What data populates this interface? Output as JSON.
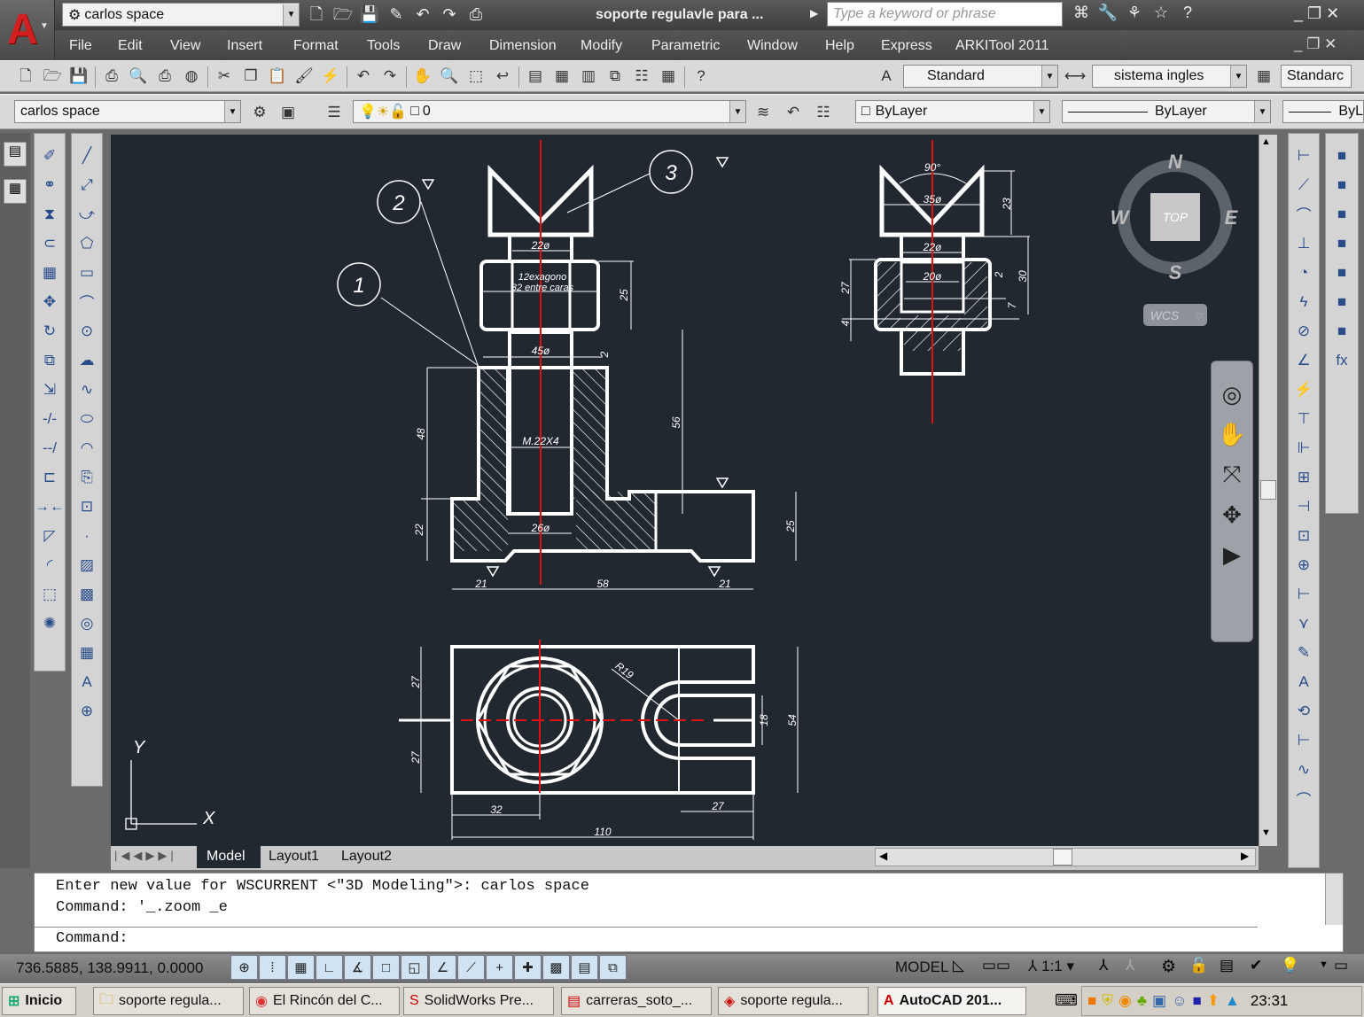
{
  "app": {
    "logo_letter": "A",
    "document_title": "soporte regulavle para ...",
    "search_placeholder": "Type a keyword or phrase",
    "workspace": "carlos space"
  },
  "menu": [
    "File",
    "Edit",
    "View",
    "Insert",
    "Format",
    "Tools",
    "Draw",
    "Dimension",
    "Modify",
    "Parametric",
    "Window",
    "Help",
    "Express",
    "ARKITool 2011"
  ],
  "quick_access": [
    "new-icon",
    "open-icon",
    "save-icon",
    "save-as-icon",
    "undo-icon",
    "redo-icon",
    "plot-icon"
  ],
  "title_icons": [
    "binoculars-icon",
    "key-icon",
    "satellite-icon",
    "star-icon",
    "help-icon"
  ],
  "toolbar1": {
    "icons": [
      "new-icon",
      "open-icon",
      "save-icon",
      "|",
      "plot-icon",
      "plot-preview-icon",
      "publish-icon",
      "3d-dwf-icon",
      "|",
      "cut-icon",
      "copy-icon",
      "paste-icon",
      "match-properties-icon",
      "block-editor-icon",
      "|",
      "undo-icon",
      "redo-icon",
      "|",
      "pan-icon",
      "zoom-realtime-icon",
      "zoom-window-icon",
      "zoom-previous-icon",
      "|",
      "properties-icon",
      "design-center-icon",
      "tool-palettes-icon",
      "sheet-set-icon",
      "markup-icon",
      "quickcalc-icon",
      "|",
      "help-icon"
    ],
    "text_style": "Standard",
    "dim_style": "sistema ingles",
    "table_style": "Standarc"
  },
  "toolbar2": {
    "workspace": "carlos space",
    "layer": "0",
    "color": "ByLayer",
    "linetype": "ByLayer",
    "lineweight": "ByL"
  },
  "draw_toolbar": [
    "line-icon",
    "construction-line-icon",
    "polyline-icon",
    "polygon-icon",
    "rectangle-icon",
    "arc-icon",
    "circle-icon",
    "revision-cloud-icon",
    "spline-icon",
    "ellipse-icon",
    "ellipse-arc-icon",
    "insert-block-icon",
    "make-block-icon",
    "point-icon",
    "hatch-icon",
    "gradient-icon",
    "region-icon",
    "table-icon",
    "text-icon",
    "add-selected-icon"
  ],
  "modify_toolbar": [
    "erase-icon",
    "copy-object-icon",
    "mirror-icon",
    "offset-icon",
    "array-icon",
    "move-icon",
    "rotate-icon",
    "scale-icon",
    "stretch-icon",
    "trim-icon",
    "extend-icon",
    "break-icon",
    "join-icon",
    "chamfer-icon",
    "fillet-icon",
    "3d-box-icon",
    "explode-icon"
  ],
  "dim_toolbar": [
    "linear-dim-icon",
    "aligned-dim-icon",
    "arc-length-icon",
    "ordinate-icon",
    "radius-icon",
    "jogged-icon",
    "diameter-icon",
    "angular-icon",
    "quick-dim-icon",
    "baseline-icon",
    "continue-icon",
    "dim-space-icon",
    "dim-break-icon",
    "tolerance-icon",
    "center-mark-icon",
    "inspection-icon",
    "jogged-linear-icon",
    "dim-edit-icon",
    "dim-text-edit-icon",
    "dim-update-icon",
    "oblique-icon",
    "jog-icon",
    "arc-icon"
  ],
  "param_toolbar": [
    "auto-constrain-icon",
    "geometric-icon",
    "dim-constrain-icon",
    "show-all-icon",
    "hide-all-icon",
    "delete-constraints-icon",
    "params-manager-icon",
    "fx-icon"
  ],
  "drawing": {
    "front": {
      "balloons": [
        "1",
        "2",
        "3"
      ],
      "dims": [
        "22ø",
        "12exagono",
        "32 entre caras",
        "25",
        "45ø",
        "2",
        "48",
        "56",
        "M.22X4",
        "22",
        "26ø",
        "25",
        "21",
        "58",
        "21"
      ]
    },
    "side": {
      "dims": [
        "90°",
        "35ø",
        "23",
        "22ø",
        "20ø",
        "2",
        "30",
        "27",
        "7",
        "4"
      ]
    },
    "top": {
      "dims": [
        "27",
        "27",
        "R19",
        "18",
        "54",
        "32",
        "27",
        "110"
      ]
    },
    "ucs": {
      "x": "X",
      "y": "Y"
    }
  },
  "viewcube": {
    "face": "TOP",
    "n": "N",
    "s": "S",
    "e": "E",
    "w": "W",
    "coord": "WCS"
  },
  "layout_tabs": [
    "Model",
    "Layout1",
    "Layout2"
  ],
  "command": {
    "history": [
      "Enter new value for WSCURRENT <\"3D Modeling\">: carlos space",
      "Command: '_.zoom _e"
    ],
    "prompt": "Command:"
  },
  "status": {
    "coords": "736.5885, 138.9911, 0.0000",
    "model": "MODEL",
    "scale": "1:1",
    "toggles": [
      "infer-constraints-icon",
      "snap-icon",
      "grid-icon",
      "ortho-icon",
      "polar-icon",
      "osnap-icon",
      "3d-osnap-icon",
      "otrack-icon",
      "ducs-icon",
      "dyn-icon",
      "lineweight-icon",
      "transparency-icon",
      "quick-props-icon",
      "selection-cycling-icon"
    ]
  },
  "taskbar": {
    "start": "Inicio",
    "clock": "23:31",
    "tasks": [
      {
        "label": "soporte regula...",
        "icon": "folder-icon"
      },
      {
        "label": "El Rincón del C...",
        "icon": "chrome-icon"
      },
      {
        "label": "SolidWorks Pre...",
        "icon": "solidworks-icon"
      },
      {
        "label": "carreras_soto_...",
        "icon": "pdf-icon"
      },
      {
        "label": "soporte regula...",
        "icon": "solidworks-doc-icon"
      },
      {
        "label": "AutoCAD 201...",
        "icon": "autocad-icon"
      }
    ]
  },
  "colors": {
    "canvas": "#212830",
    "centerline": "#e01010",
    "geometry": "#ffffff",
    "brand": "#d21f1f"
  }
}
